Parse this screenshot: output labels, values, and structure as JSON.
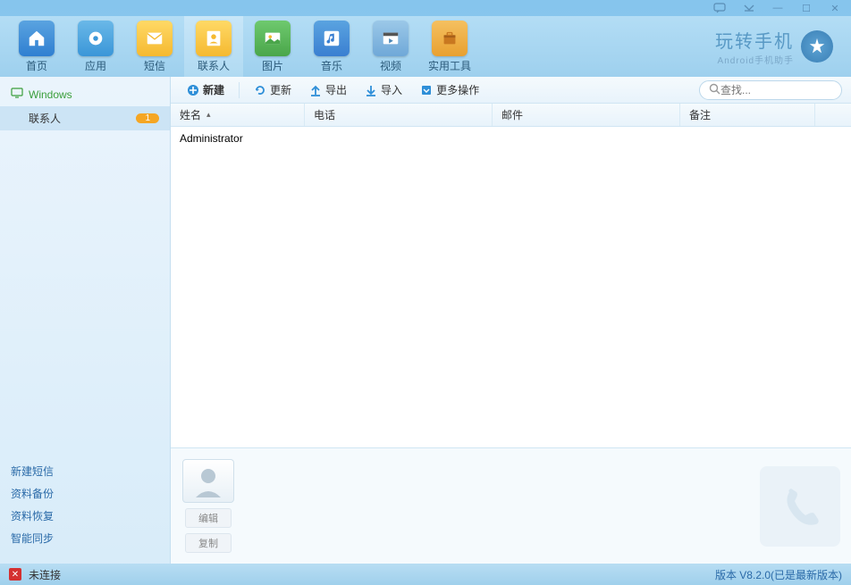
{
  "titlebar": {
    "feedback": "⋯",
    "dropdown": "▽",
    "min": "—",
    "max": "☐",
    "close": "✕"
  },
  "nav": {
    "items": [
      {
        "label": "首页",
        "bg": "#2f7fd1"
      },
      {
        "label": "应用",
        "bg": "#3a96d8"
      },
      {
        "label": "短信",
        "bg": "#f5b930"
      },
      {
        "label": "联系人",
        "bg": "#f5b930"
      },
      {
        "label": "图片",
        "bg": "#4aa64a"
      },
      {
        "label": "音乐",
        "bg": "#3a7fd1"
      },
      {
        "label": "视频",
        "bg": "#6fa8d8"
      },
      {
        "label": "实用工具",
        "bg": "#e8a030"
      }
    ],
    "active": 3
  },
  "brand": {
    "title": "玩转手机",
    "sub": "Android手机助手"
  },
  "sidebar": {
    "root": "Windows",
    "items": [
      {
        "label": "联系人",
        "count": "1"
      }
    ],
    "links": [
      "新建短信",
      "资料备份",
      "资料恢复",
      "智能同步"
    ]
  },
  "toolbar": {
    "new": "新建",
    "refresh": "更新",
    "export": "导出",
    "import": "导入",
    "more": "更多操作",
    "search_placeholder": "查找..."
  },
  "table": {
    "headers": {
      "name": "姓名",
      "phone": "电话",
      "email": "邮件",
      "note": "备注"
    },
    "rows": [
      {
        "name": "Administrator",
        "phone": "",
        "email": "",
        "note": ""
      }
    ]
  },
  "detail": {
    "edit": "编辑",
    "copy": "复制"
  },
  "status": {
    "text": "未连接",
    "version": "版本 V8.2.0(已是最新版本)"
  }
}
